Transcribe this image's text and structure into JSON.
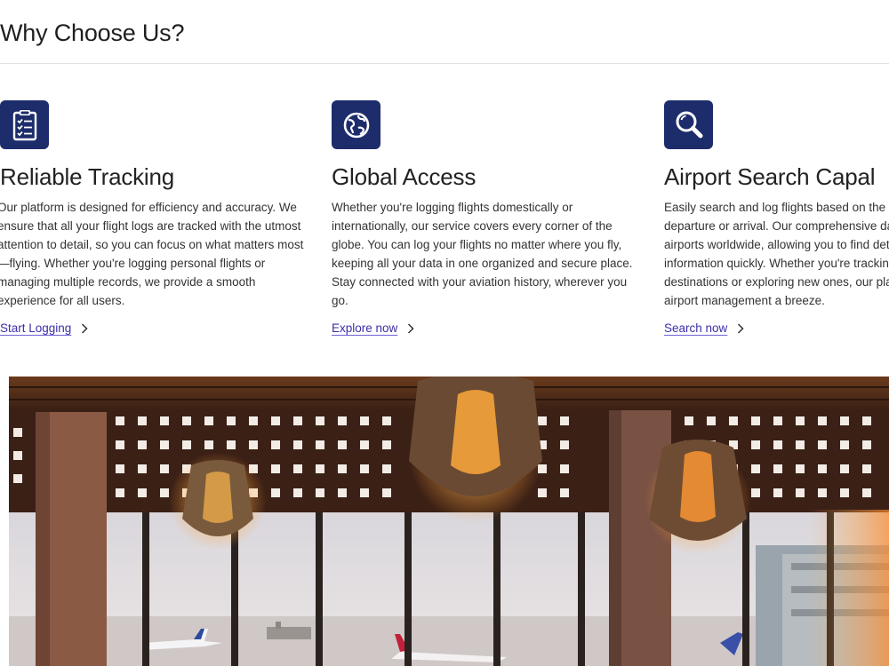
{
  "section": {
    "title": "Why Choose Us?"
  },
  "features": [
    {
      "icon": "clipboard-checklist-icon",
      "title": "Reliable Tracking",
      "text": "Our platform is designed for efficiency and accuracy. We ensure that all your flight logs are tracked with the utmost attention to detail, so you can focus on what matters most—flying. Whether you're logging personal flights or managing multiple records, we provide a smooth experience for all users.",
      "cta": "Start Logging"
    },
    {
      "icon": "globe-icon",
      "title": "Global Access",
      "text": "Whether you're logging flights domestically or internationally, our service covers every corner of the globe. You can log your flights no matter where you fly, keeping all your data in one organized and secure place. Stay connected with your aviation history, wherever you go.",
      "cta": "Explore now"
    },
    {
      "icon": "magnifier-icon",
      "title": "Airport Search Capal",
      "text_lines": [
        "Easily search and log flights based on the",
        "departure or arrival. Our comprehensive da",
        "airports worldwide, allowing you to find det",
        "information quickly. Whether you're trackin",
        "destinations or exploring new ones, our pla",
        "airport management a breeze."
      ],
      "cta": "Search now"
    }
  ],
  "colors": {
    "icon_bg": "#1d2c6b",
    "link": "#3b2fa8"
  }
}
